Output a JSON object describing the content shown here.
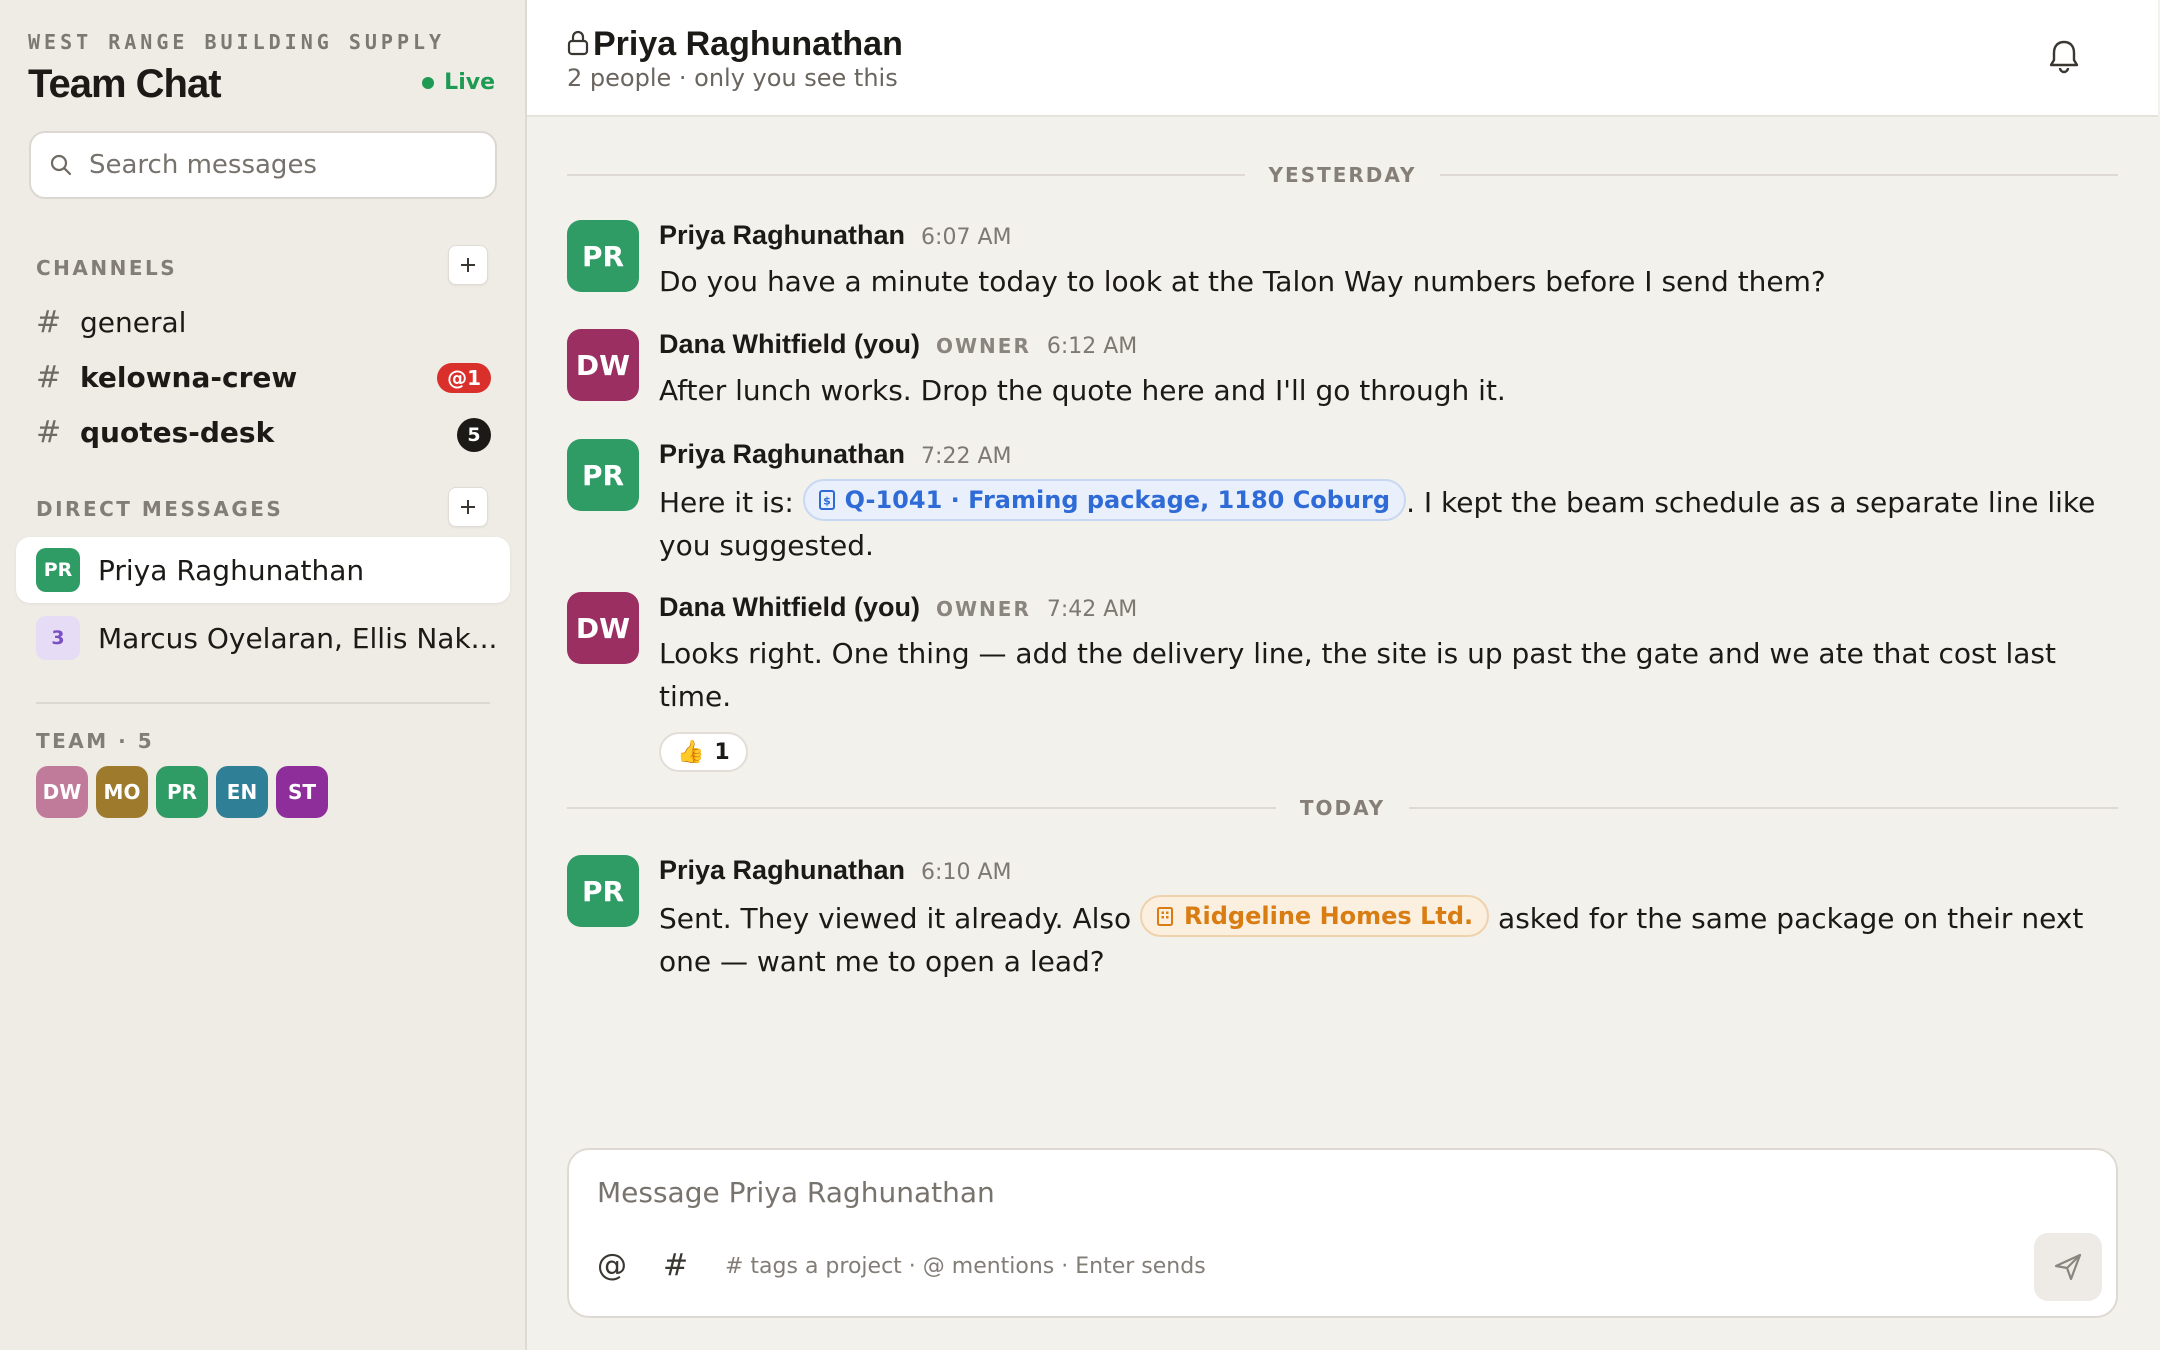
{
  "sidebar": {
    "org_name": "WEST RANGE BUILDING SUPPLY",
    "app_title": "Team Chat",
    "live_label": "Live",
    "search_placeholder": "Search messages",
    "channels_heading": "CHANNELS",
    "channels": [
      {
        "name": "general",
        "badge": ""
      },
      {
        "name": "kelowna-crew",
        "badge": "@1"
      },
      {
        "name": "quotes-desk",
        "badge": "5"
      }
    ],
    "dm_heading": "DIRECT MESSAGES",
    "dms": [
      {
        "avatar": "PR",
        "name": "Priya Raghunathan",
        "active": true,
        "color": "#2f9b65"
      },
      {
        "avatar": "3",
        "name": "Marcus Oyelaran, Ellis Nak...",
        "active": false,
        "color": "#e6dcf5"
      }
    ],
    "team_heading": "TEAM · 5",
    "team": [
      {
        "initials": "DW",
        "color": "#c07a9a"
      },
      {
        "initials": "MO",
        "color": "#9e7a2c"
      },
      {
        "initials": "PR",
        "color": "#2f9b65"
      },
      {
        "initials": "EN",
        "color": "#2f7f97"
      },
      {
        "initials": "ST",
        "color": "#8e2e9a"
      }
    ]
  },
  "header": {
    "title": "Priya Raghunathan",
    "subtitle": "2 people · only you see this"
  },
  "conversation": {
    "separators": [
      "YESTERDAY",
      "TODAY"
    ],
    "messages": [
      {
        "avatar": "PR",
        "author": "Priya Raghunathan",
        "role": "",
        "time": "6:07 AM",
        "text": "Do you have a minute today to look at the Talon Way numbers before I send them?"
      },
      {
        "avatar": "DW",
        "author": "Dana Whitfield (you)",
        "role": "OWNER",
        "time": "6:12 AM",
        "text": "After lunch works. Drop the quote here and I'll go through it."
      },
      {
        "avatar": "PR",
        "author": "Priya Raghunathan",
        "role": "",
        "time": "7:22 AM",
        "text_before": "Here it is:",
        "chip": "Q-1041 · Framing package, 1180 Coburg",
        "text_after": ". I kept the beam schedule as a separate line like you suggested."
      },
      {
        "avatar": "DW",
        "author": "Dana Whitfield (you)",
        "role": "OWNER",
        "time": "7:42 AM",
        "text": "Looks right. One thing — add the delivery line, the site is up past the gate and we ate that cost last time.",
        "reaction_emoji": "👍",
        "reaction_count": "1"
      },
      {
        "avatar": "PR",
        "author": "Priya Raghunathan",
        "role": "",
        "time": "6:10 AM",
        "text_before": "Sent. They viewed it already. Also",
        "chip": "Ridgeline Homes Ltd.",
        "text_after": "asked for the same package on their next one — want me to open a lead?"
      }
    ]
  },
  "composer": {
    "placeholder": "Message Priya Raghunathan",
    "at_symbol": "@",
    "hash_symbol": "#",
    "hint": "# tags a project · @ mentions · Enter sends"
  },
  "colors": {
    "accent_green": "#1e9a53",
    "mention_red": "#d9302c",
    "pr_avatar": "#2f9b65",
    "dw_avatar": "#9b2f62",
    "chip_blue": "#2f6bd6",
    "chip_orange": "#d97d13"
  },
  "icons": [
    "search-icon",
    "plus-icon",
    "lock-icon",
    "bell-icon",
    "receipt-icon",
    "building-icon",
    "send-icon"
  ]
}
